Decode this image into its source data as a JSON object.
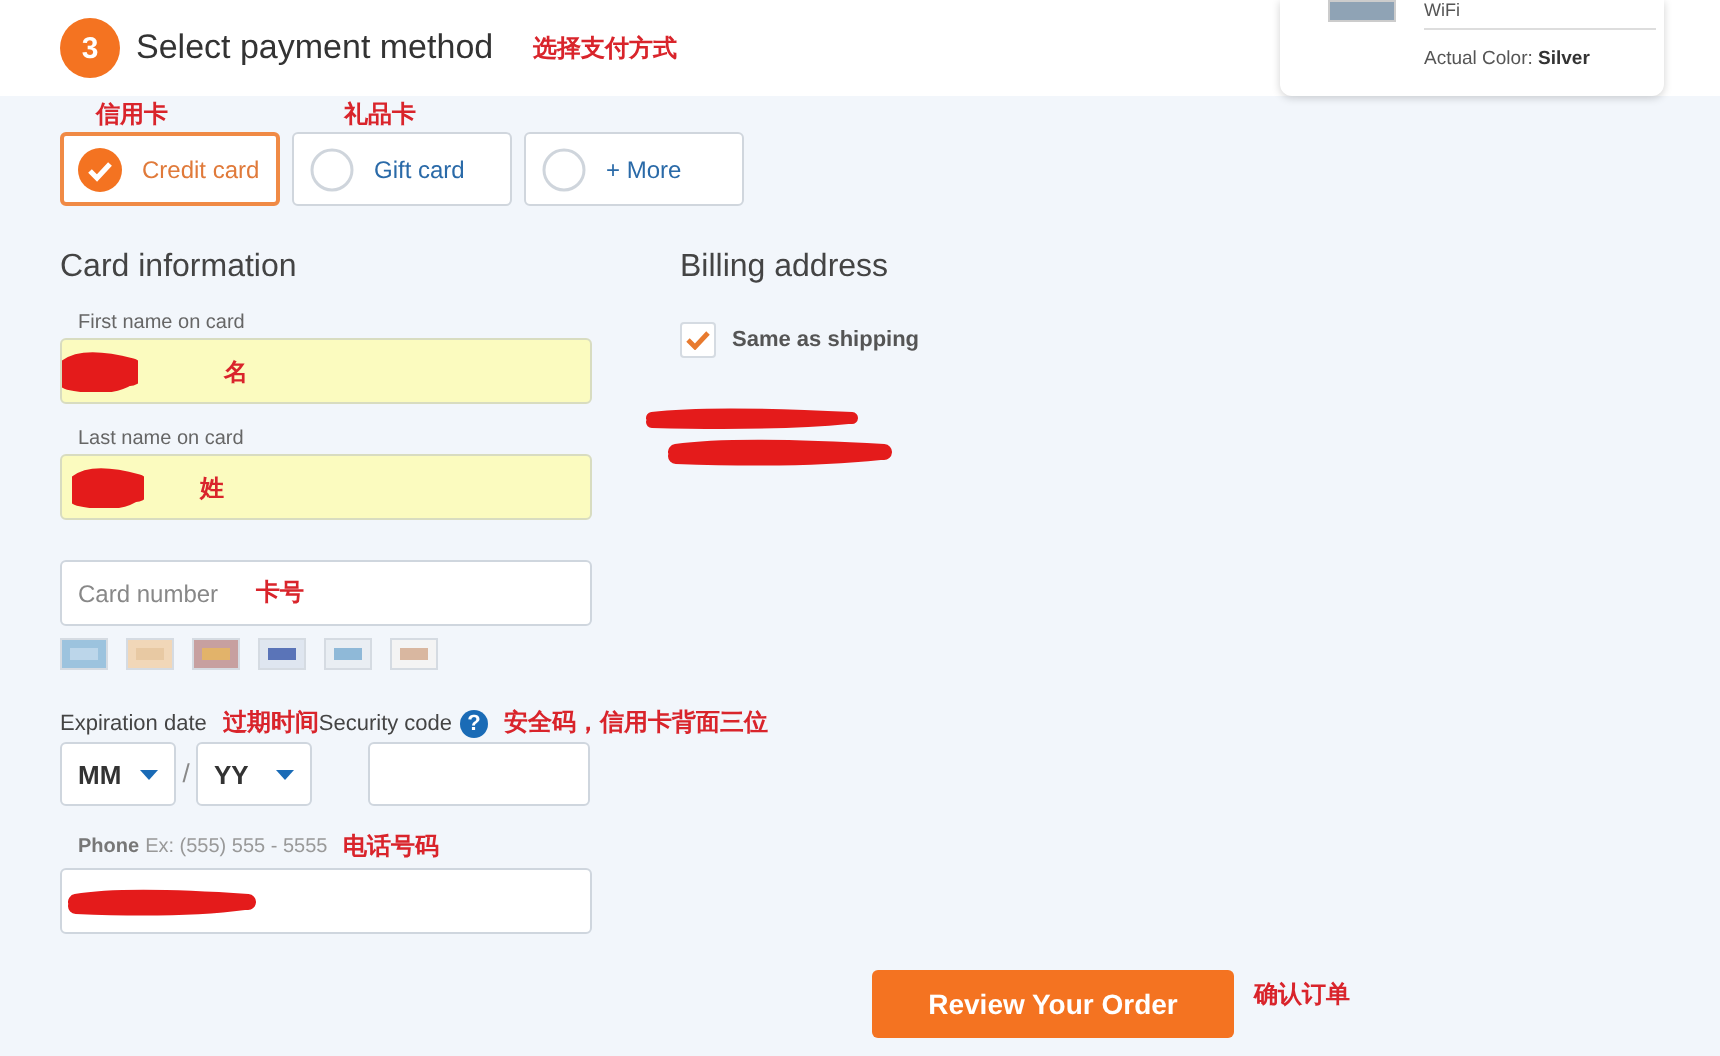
{
  "summary_card": {
    "line": "WiFi",
    "detail": "Actual Color: **Silver**"
  },
  "header": {
    "step": "3",
    "title": "Select payment method",
    "note": "选择支付方式"
  },
  "payment_methods": [
    {
      "label": "Credit card",
      "selected": true,
      "note": "信用卡"
    },
    {
      "label": "Gift card",
      "selected": false,
      "note": "礼品卡"
    },
    {
      "label": "+ More",
      "selected": false
    }
  ],
  "card_information": {
    "heading": "Card information",
    "first_name": {
      "label": "First name on card",
      "note": "名"
    },
    "last_name": {
      "label": "Last name on card",
      "note": "姓"
    },
    "card_number": {
      "placeholder": "Card number",
      "note": "卡号"
    },
    "expiration": {
      "label": "Expiration date",
      "note": "过期时间",
      "month": "MM",
      "separator": "/",
      "year": "YY"
    },
    "security_code": {
      "label": "Security code",
      "help": "?",
      "note": "安全码，信用卡背面三位"
    },
    "phone": {
      "label": "Phone",
      "hint": "Ex: (555) 555 - 5555",
      "note": "电话号码"
    }
  },
  "billing_address": {
    "heading": "Billing address",
    "same_as_shipping": {
      "label": "Same as shipping",
      "checked": true
    }
  },
  "review_button": {
    "label": "Review Your Order",
    "note": "确认订单"
  }
}
